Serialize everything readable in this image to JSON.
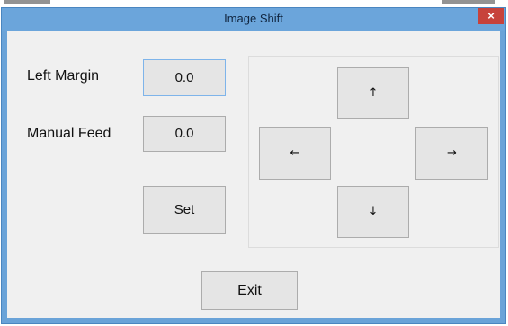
{
  "window": {
    "title": "Image Shift",
    "close_label": "×"
  },
  "left_margin": {
    "label": "Left Margin",
    "value": "0.0"
  },
  "manual_feed": {
    "label": "Manual Feed",
    "value": "0.0"
  },
  "buttons": {
    "set_label": "Set",
    "exit_label": "Exit",
    "up_label": "↑",
    "down_label": "↓",
    "left_label": "←",
    "right_label": "→"
  }
}
